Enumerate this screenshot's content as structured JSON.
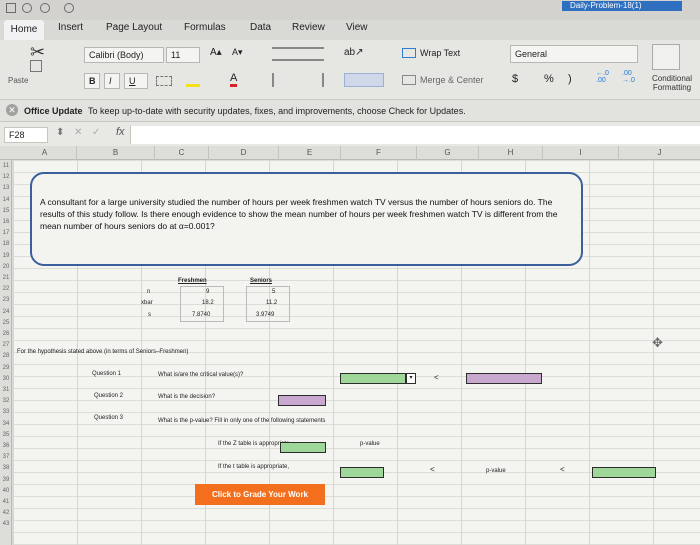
{
  "title_bar": {
    "title": "Daily-Problem-18(1)"
  },
  "tabs": [
    "Home",
    "Insert",
    "Page Layout",
    "Formulas",
    "Data",
    "Review",
    "View"
  ],
  "ribbon": {
    "paste_label": "Paste",
    "font_name": "Calibri (Body)",
    "font_size": "11",
    "grow_font": "A▴",
    "shrink_font": "A▾",
    "bold": "B",
    "italic": "I",
    "underline": "U",
    "wrap_text": "Wrap Text",
    "merge_center": "Merge & Center",
    "number_format": "General",
    "currency": "$",
    "percent": "%",
    "comma": ")",
    "inc_decimal": "←.0\n.00",
    "dec_decimal": ".00\n→.0",
    "conditional_formatting": "Conditional Formatting"
  },
  "notification": {
    "title": "Office Update",
    "message": "To keep up-to-date with security updates, fixes, and improvements, choose Check for Updates."
  },
  "formula_bar": {
    "name_box": "F28",
    "fx": "fx",
    "value": ""
  },
  "columns": [
    "A",
    "B",
    "C",
    "D",
    "E",
    "F",
    "G",
    "H",
    "I",
    "J"
  ],
  "rows": [
    "11",
    "12",
    "13",
    "14",
    "15",
    "16",
    "17",
    "18",
    "19",
    "20",
    "21",
    "22",
    "23",
    "24",
    "25",
    "26",
    "27",
    "28",
    "29",
    "30",
    "31",
    "32",
    "33",
    "34",
    "35",
    "36",
    "37",
    "38",
    "39",
    "40",
    "41",
    "42",
    "43"
  ],
  "problem_text": "A consultant for a large university studied the number of hours per week freshmen watch TV versus the number of hours seniors do. The results of this study follow. Is there enough evidence to show the mean number of hours per week freshmen watch TV is different from the mean number of hours seniors do at α=0.001?",
  "table": {
    "headers": [
      "Freshmen",
      "Seniors"
    ],
    "row_labels": [
      "n",
      "xbar",
      "s"
    ],
    "freshmen": [
      "9",
      "18.2",
      "7.8740"
    ],
    "seniors": [
      "5",
      "11.2",
      "3.9749"
    ]
  },
  "hypothesis_prompt": "For the hypothesis stated above (in terms of Seniors–Freshmen)",
  "questions": [
    {
      "label": "Question 1",
      "text": "What is/are the critical value(s)?"
    },
    {
      "label": "Question 2",
      "text": "What is the decision?"
    },
    {
      "label": "Question 3",
      "text": "What is the p-value? Fill in only one of the following statements"
    }
  ],
  "statements": [
    {
      "text": "If the Z table is appropriate,",
      "answer_label": "p-value",
      "symbol": ""
    },
    {
      "text": "If the t table is appropriate,",
      "answer_label": "p-value",
      "symbol": "<"
    }
  ],
  "symbols": {
    "lt1": "<",
    "lt2": "<",
    "lt3": "<"
  },
  "grade_button": "Click to Grade Your Work",
  "colors": {
    "green_cell": "#9fd69a",
    "purple_cell": "#c9a8d0",
    "orange": "#f36f1d",
    "border_blue": "#3a5f9c"
  }
}
